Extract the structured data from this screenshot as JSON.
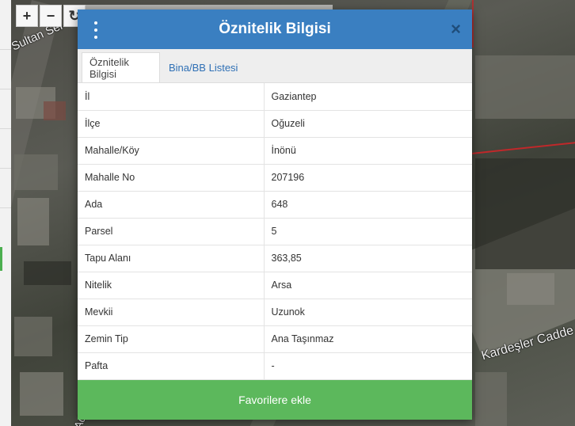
{
  "map": {
    "streets": {
      "sultan": "Sultan Sel",
      "adnan": "Adnan M",
      "kardesler": "Kardeşler Cadde"
    },
    "controls": {
      "zoom_in": "+",
      "zoom_out": "−",
      "refresh": "↻"
    }
  },
  "dialog": {
    "title": "Öznitelik Bilgisi",
    "menu_icon": "vertical-dots-icon",
    "close_label": "×",
    "tabs": [
      {
        "label": "Öznitelik Bilgisi",
        "active": true
      },
      {
        "label": "Bina/BB Listesi",
        "active": false
      }
    ],
    "rows": [
      {
        "key": "İl",
        "value": "Gaziantep"
      },
      {
        "key": "İlçe",
        "value": "Oğuzeli"
      },
      {
        "key": "Mahalle/Köy",
        "value": "İnönü"
      },
      {
        "key": "Mahalle No",
        "value": "207196"
      },
      {
        "key": "Ada",
        "value": "648"
      },
      {
        "key": "Parsel",
        "value": "5"
      },
      {
        "key": "Tapu Alanı",
        "value": "363,85"
      },
      {
        "key": "Nitelik",
        "value": "Arsa"
      },
      {
        "key": "Mevkii",
        "value": "Uzunok"
      },
      {
        "key": "Zemin Tip",
        "value": "Ana Taşınmaz"
      },
      {
        "key": "Pafta",
        "value": "-"
      }
    ],
    "favorite_button": "Favorilere ekle"
  },
  "colors": {
    "header": "#3a7fc1",
    "button": "#5cb85c",
    "tab_link": "#2f70b5"
  }
}
